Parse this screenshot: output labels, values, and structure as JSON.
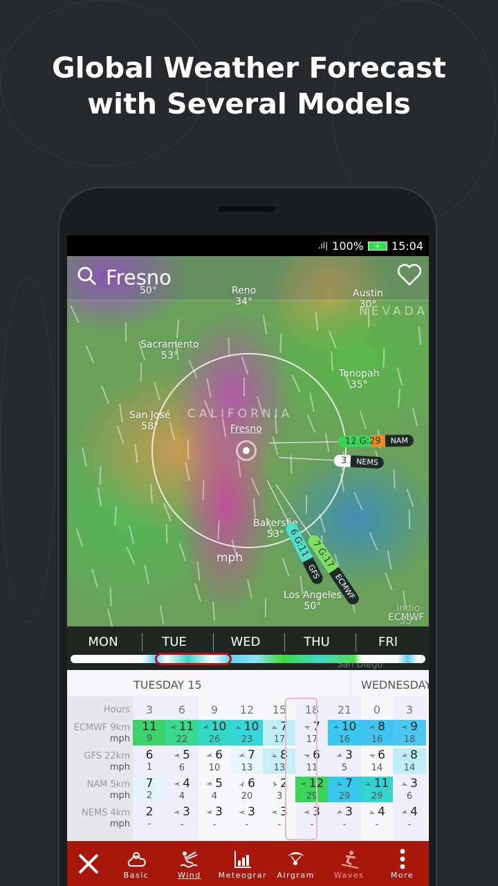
{
  "headline": [
    "Global Weather Forecast",
    "with Several Models"
  ],
  "status": {
    "signal": ".ıl|",
    "battery": "100%",
    "battery_icon": "+",
    "time": "15:04"
  },
  "map": {
    "location": "Fresno",
    "cities": [
      {
        "name": "Reno",
        "temp": "34°"
      },
      {
        "name": "Austin",
        "temp": "30°"
      },
      {
        "name": "",
        "temp": "50°"
      },
      {
        "name": "Sacramento",
        "temp": "53°"
      },
      {
        "name": "Tonopah",
        "temp": "35°"
      },
      {
        "name": "San José",
        "temp": "58°"
      },
      {
        "name": "Bakersfie",
        "temp": "53°"
      },
      {
        "name": "Los Angeles",
        "temp": "50°"
      },
      {
        "name": "Indio",
        "temp": "55°"
      }
    ],
    "states": [
      "NEVADA",
      "CALIFORNIA"
    ],
    "pin_label": "Fresno",
    "unit": "mph",
    "model_label": "ECMWF",
    "san_diego": "San Diego",
    "flags": [
      {
        "model": "NAM",
        "value": "12 G:29",
        "color": "#3ad45a"
      },
      {
        "model": "NEMS",
        "value": "3",
        "color": "#ffffff"
      },
      {
        "model": "ECMWF",
        "value": "7 G:17",
        "color": "#7ee060"
      },
      {
        "model": "GFS",
        "value": "6 G:11",
        "color": "#4ee0c8"
      }
    ]
  },
  "days": [
    "MON",
    "TUE",
    "WED",
    "THU",
    "FRI"
  ],
  "table": {
    "day_headers": [
      "TUESDAY 15",
      "WEDNESDAY"
    ],
    "hours_label": "Hours",
    "hours": [
      "3",
      "6",
      "9",
      "12",
      "15",
      "18",
      "21",
      "0",
      "3"
    ],
    "selected_hour": "18",
    "models": [
      {
        "name": "ECMWF 9km",
        "unit": "mph",
        "speed": [
          "11",
          "11",
          "10",
          "10",
          "7",
          "7",
          "10",
          "8",
          "9"
        ],
        "gust": [
          "9",
          "22",
          "26",
          "23",
          "17",
          "17",
          "16",
          "16",
          "18"
        ],
        "dir": [
          null,
          180,
          160,
          20,
          20,
          200,
          160,
          160,
          180
        ],
        "bg": [
          "#3ad46a",
          "#38d88e",
          "#34d8c6",
          "#34d8d8",
          "#bfeef6",
          "",
          "#38c8f0",
          "#40c4f0",
          "#48c8f2"
        ]
      },
      {
        "name": "GFS 22km",
        "unit": "mph",
        "speed": [
          "6",
          "5",
          "6",
          "7",
          "8",
          "6",
          "3",
          "6",
          "8"
        ],
        "gust": [
          "1",
          "6",
          "10",
          "13",
          "13",
          "11",
          "5",
          "14",
          "14"
        ],
        "dir": [
          null,
          180,
          160,
          160,
          20,
          200,
          160,
          200,
          160
        ],
        "bg": [
          "",
          "",
          "",
          "#e6f6fb",
          "#c8eef8",
          "",
          "",
          "",
          "#c0ecf8"
        ]
      },
      {
        "name": "NAM 5km",
        "unit": "mph",
        "speed": [
          "7",
          "4",
          "5",
          "6",
          "2",
          "12",
          "7",
          "11",
          "3"
        ],
        "gust": [
          "2",
          "4",
          "4",
          "20",
          "3",
          "29",
          "29",
          "29",
          "6"
        ],
        "dir": [
          null,
          180,
          180,
          -60,
          -120,
          180,
          20,
          30,
          20
        ],
        "bg": [
          "#e2f4fb",
          "",
          "",
          "",
          "",
          "#3ad458",
          "#38c8ec",
          "#34d2d0",
          ""
        ],
        "sep": true
      },
      {
        "name": "NEMS 4km",
        "unit": "mph",
        "speed": [
          "2",
          "3",
          "3",
          "3",
          "3",
          "3",
          "3",
          "4",
          "4"
        ],
        "gust": [
          "-",
          "-",
          "-",
          "-",
          "-",
          "-",
          "-",
          "-",
          "-"
        ],
        "dir": [
          null,
          180,
          180,
          180,
          180,
          180,
          160,
          20,
          160
        ],
        "bg": [
          "",
          "",
          "",
          "",
          "",
          "",
          "",
          "",
          ""
        ]
      }
    ]
  },
  "bottom_nav": [
    {
      "label": "",
      "icon": "close-icon"
    },
    {
      "label": "Basic",
      "icon": "cloud-sun-icon"
    },
    {
      "label": "Wind",
      "icon": "kitesurf-icon",
      "active": true
    },
    {
      "label": "Meteograr",
      "icon": "bar-chart-icon"
    },
    {
      "label": "Airgram",
      "icon": "paraglider-icon"
    },
    {
      "label": "Waves",
      "icon": "surfer-icon",
      "disabled": true
    },
    {
      "label": "More",
      "icon": "more-vertical-icon"
    }
  ],
  "colors": {
    "accent": "#a8180a",
    "background": "#26282c"
  }
}
